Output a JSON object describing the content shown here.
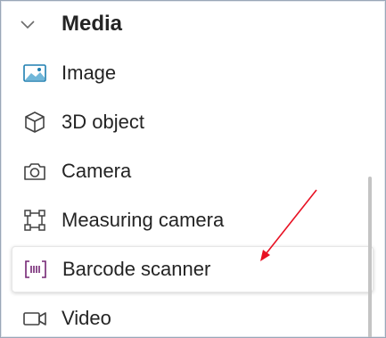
{
  "section": {
    "title": "Media",
    "expanded": true,
    "chevron_icon": "chevron-down-icon"
  },
  "items": [
    {
      "label": "Image",
      "icon": "image-icon"
    },
    {
      "label": "3D object",
      "icon": "cube-icon"
    },
    {
      "label": "Camera",
      "icon": "camera-icon"
    },
    {
      "label": "Measuring camera",
      "icon": "measuring-camera-icon"
    },
    {
      "label": "Barcode scanner",
      "icon": "barcode-scanner-icon",
      "selected": true
    },
    {
      "label": "Video",
      "icon": "video-icon"
    }
  ],
  "colors": {
    "text": "#242424",
    "image_icon_blue": "#1e7fb0",
    "barcode_icon_purple": "#742774",
    "annotation_arrow": "#e81123",
    "border": "#9aa7b8"
  }
}
